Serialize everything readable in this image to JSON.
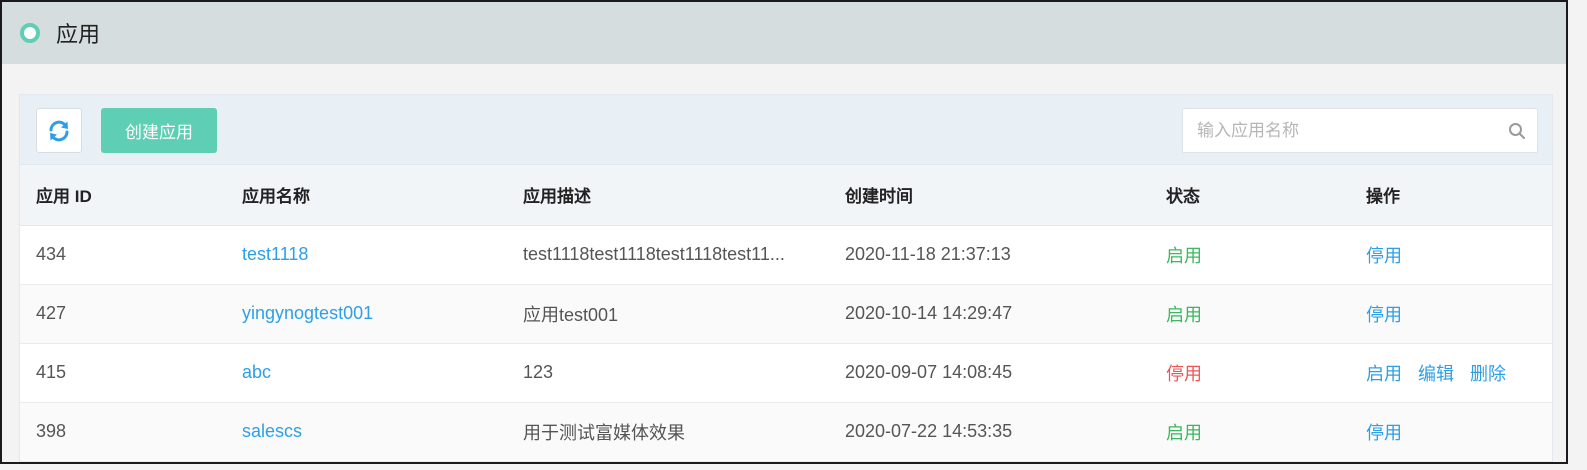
{
  "header": {
    "title": "应用"
  },
  "toolbar": {
    "refresh_icon": "refresh-icon",
    "create_label": "创建应用",
    "search_placeholder": "输入应用名称",
    "search_value": ""
  },
  "table": {
    "columns": [
      "应用 ID",
      "应用名称",
      "应用描述",
      "创建时间",
      "状态",
      "操作"
    ],
    "rows": [
      {
        "id": "434",
        "name": "test1118",
        "desc": "test1118test1118test1118test11...",
        "created": "2020-11-18 21:37:13",
        "status": "启用",
        "status_state": "on",
        "actions": [
          "停用"
        ]
      },
      {
        "id": "427",
        "name": "yingynogtest001",
        "desc": "应用test001",
        "created": "2020-10-14 14:29:47",
        "status": "启用",
        "status_state": "on",
        "actions": [
          "停用"
        ]
      },
      {
        "id": "415",
        "name": "abc",
        "desc": "123",
        "created": "2020-09-07 14:08:45",
        "status": "停用",
        "status_state": "off",
        "actions": [
          "启用",
          "编辑",
          "删除"
        ]
      },
      {
        "id": "398",
        "name": "salescs",
        "desc": "用于测试富媒体效果",
        "created": "2020-07-22 14:53:35",
        "status": "启用",
        "status_state": "on",
        "actions": [
          "停用"
        ]
      }
    ]
  },
  "colors": {
    "accent": "#5ecfb4",
    "link": "#2e9fe6",
    "status_on": "#3bb85e",
    "status_off": "#ef5555"
  }
}
